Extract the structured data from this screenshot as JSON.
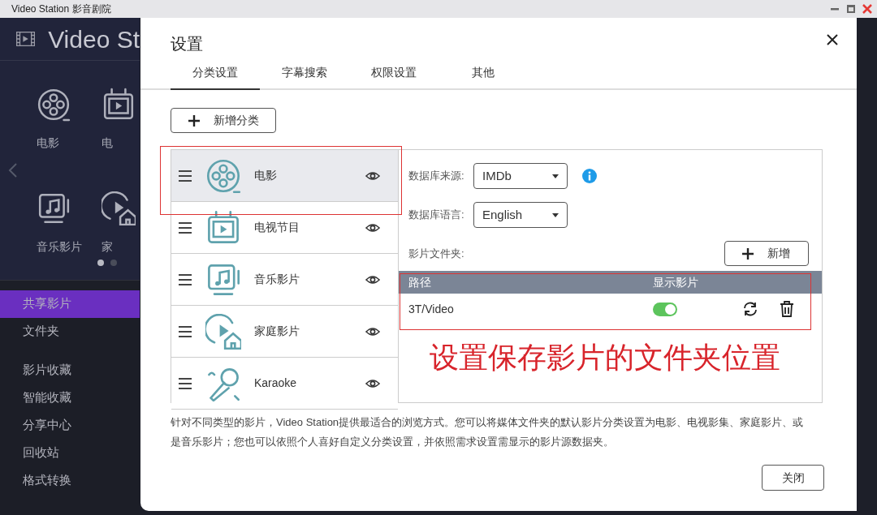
{
  "window": {
    "title": "Video Station 影音剧院"
  },
  "app": {
    "brand": "Video St",
    "categories": [
      {
        "label": "电影",
        "kind": "reel"
      },
      {
        "label": "电",
        "kind": "tv"
      },
      {
        "label": "音乐影片",
        "kind": "music"
      },
      {
        "label": "家",
        "kind": "home"
      }
    ],
    "pager": [
      {
        "selected": true
      },
      {
        "selected": false
      }
    ],
    "nav": [
      {
        "items": [
          {
            "label": "共享影片",
            "selected": true
          },
          {
            "label": "文件夹",
            "selected": false
          }
        ]
      },
      {
        "items": [
          {
            "label": "影片收藏",
            "selected": false
          },
          {
            "label": "智能收藏",
            "selected": false
          },
          {
            "label": "分享中心",
            "selected": false
          },
          {
            "label": "回收站",
            "selected": false
          },
          {
            "label": "格式转换",
            "selected": false
          }
        ]
      }
    ]
  },
  "dialog": {
    "title": "设置",
    "tabs": [
      {
        "label": "分类设置",
        "selected": true
      },
      {
        "label": "字幕搜索",
        "selected": false
      },
      {
        "label": "权限设置",
        "selected": false
      },
      {
        "label": "其他",
        "selected": false
      }
    ],
    "add_button": "新增分类",
    "categories": [
      {
        "label": "电影",
        "kind": "reel",
        "selected": true
      },
      {
        "label": "电视节目",
        "kind": "tv",
        "selected": false
      },
      {
        "label": "音乐影片",
        "kind": "music",
        "selected": false
      },
      {
        "label": "家庭影片",
        "kind": "home",
        "selected": false
      },
      {
        "label": "Karaoke",
        "kind": "mic",
        "selected": false
      }
    ],
    "fields": [
      {
        "label": "数据库来源:",
        "value": "IMDb",
        "info": true
      },
      {
        "label": "数据库语言:",
        "value": "English",
        "info": false
      }
    ],
    "folders": {
      "label": "影片文件夹:",
      "add_button": "新增",
      "columns": [
        "路径",
        "显示影片"
      ],
      "rows": [
        {
          "path": "3T/Video",
          "on": true
        }
      ]
    },
    "description": "针对不同类型的影片，Video Station提供最适合的浏览方式。您可以将媒体文件夹的默认影片分类设置为电影、电视影集、家庭影片、或是音乐影片；您也可以依照个人喜好自定义分类设置，并依照需求设置需显示的影片源数据夹。",
    "close_button": "关闭"
  },
  "annotation": {
    "text": "设置保存影片的文件夹位置"
  }
}
